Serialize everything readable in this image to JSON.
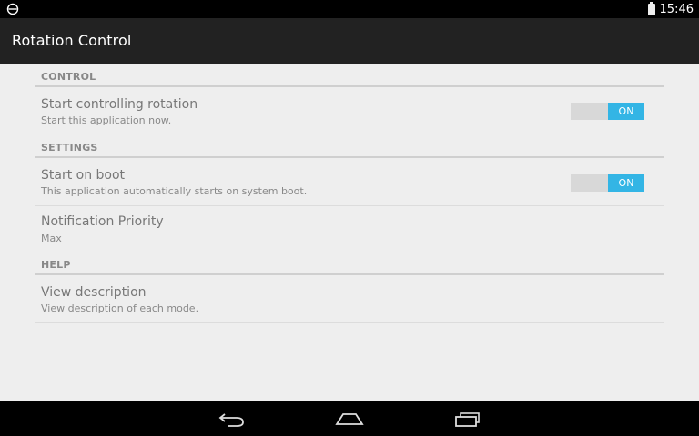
{
  "status_bar": {
    "time": "15:46",
    "left_icon": "notification-icon",
    "battery_icon": "battery-icon"
  },
  "action_bar": {
    "title": "Rotation Control"
  },
  "sections": {
    "control": {
      "header": "CONTROL"
    },
    "settings": {
      "header": "SETTINGS"
    },
    "help": {
      "header": "HELP"
    }
  },
  "prefs": {
    "start_rotation": {
      "title": "Start controlling rotation",
      "summary": "Start this application now.",
      "switch_label": "ON",
      "switch_on": true
    },
    "start_on_boot": {
      "title": "Start on boot",
      "summary": "This application automatically starts on system boot.",
      "switch_label": "ON",
      "switch_on": true
    },
    "notification_priority": {
      "title": "Notification Priority",
      "summary": "Max"
    },
    "view_description": {
      "title": "View description",
      "summary": "View description of each mode."
    }
  },
  "nav": {
    "back_icon": "back-icon",
    "home_icon": "home-icon",
    "recents_icon": "recents-icon"
  },
  "colors": {
    "accent": "#33b5e5",
    "action_bar": "#222222",
    "background": "#eeeeee"
  }
}
